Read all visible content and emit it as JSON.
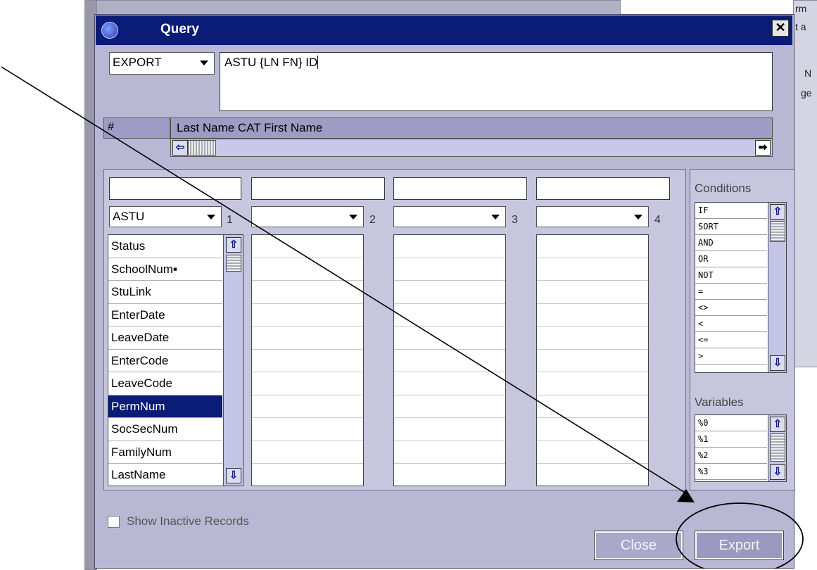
{
  "dialog": {
    "title": "Query",
    "close_glyph": "✕",
    "mode_select": "EXPORT",
    "query_text": "ASTU {LN FN} ID",
    "header_hash": "#",
    "header_col": "Last Name CAT First Name",
    "scroll_left_glyph": "⇦",
    "scroll_right_glyph": "➡",
    "columns": [
      {
        "table": "ASTU",
        "number": "1"
      },
      {
        "table": "",
        "number": "2"
      },
      {
        "table": "",
        "number": "3"
      },
      {
        "table": "",
        "number": "4"
      }
    ],
    "fields": [
      "Status",
      "SchoolNum▪",
      "StuLink",
      "EnterDate",
      "LeaveDate",
      "EnterCode",
      "LeaveCode",
      "PermNum",
      "SocSecNum",
      "FamilyNum",
      "LastName"
    ],
    "selected_field": "PermNum",
    "conditions_label": "Conditions",
    "conditions": [
      "IF",
      "SORT",
      "AND",
      "OR",
      "NOT",
      "=",
      "<>",
      "<",
      "<=",
      ">"
    ],
    "variables_label": "Variables",
    "variables": [
      "%0",
      "%1",
      "%2",
      "%3"
    ],
    "show_inactive_label": "Show Inactive Records",
    "close_button": "Close",
    "export_button": "Export",
    "scroll_up_glyph": "⇧",
    "scroll_down_glyph": "⇩"
  },
  "background": {
    "top_fragment": "rm",
    "right_fragments": [
      "t a",
      "N",
      "ge"
    ]
  },
  "colors": {
    "titlebar": "#0a1b78",
    "dialog_bg": "#b8b8d4",
    "selection": "#0a1b78"
  }
}
